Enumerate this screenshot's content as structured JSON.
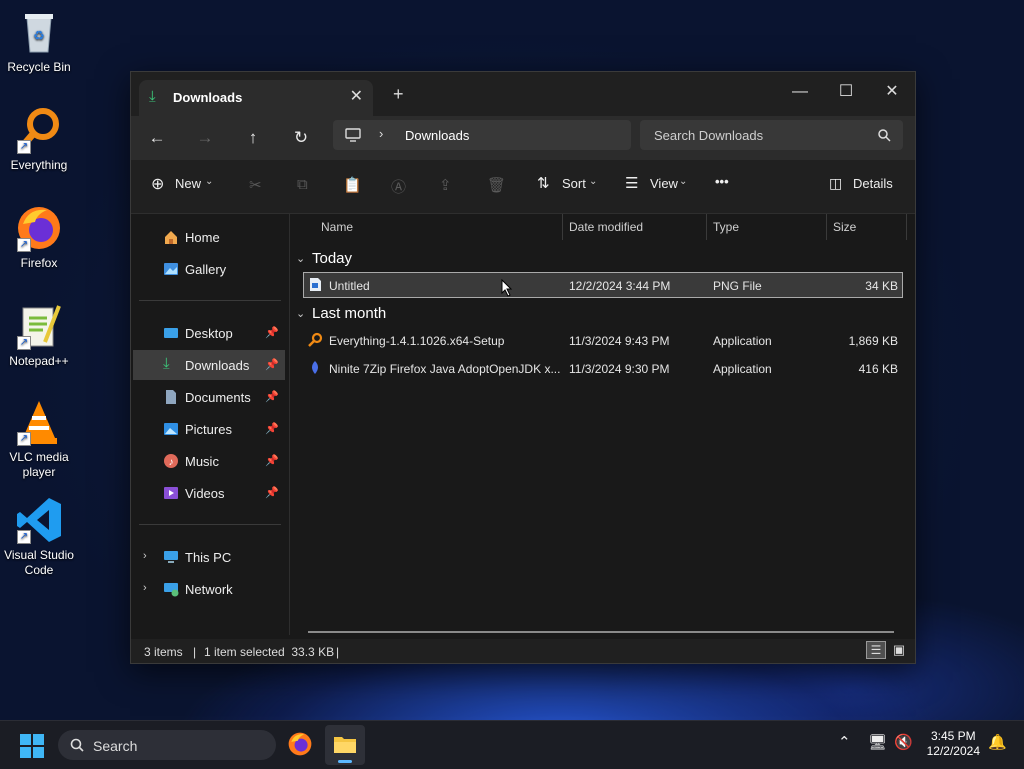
{
  "desktop": {
    "icons": [
      {
        "label": "Recycle Bin"
      },
      {
        "label": "Everything"
      },
      {
        "label": "Firefox"
      },
      {
        "label": "Notepad++"
      },
      {
        "label": "VLC media player"
      },
      {
        "label": "Visual Studio Code"
      }
    ]
  },
  "window": {
    "tab_title": "Downloads",
    "tab_close": "✕",
    "new_tab": "+",
    "minimize": "—",
    "maximize": "☐",
    "close": "✕"
  },
  "nav": {
    "back": "←",
    "forward": "→",
    "up": "↑",
    "refresh": "↻",
    "address": "Downloads",
    "search_placeholder": "Search Downloads"
  },
  "command_bar": {
    "new_label": "New",
    "sort_label": "Sort",
    "view_label": "View",
    "more": "•••",
    "details_label": "Details"
  },
  "sidebar": {
    "items": [
      {
        "label": "Home",
        "icon": "home-icon"
      },
      {
        "label": "Gallery",
        "icon": "gallery-icon"
      },
      {
        "label": "Desktop",
        "icon": "desktop-icon"
      },
      {
        "label": "Downloads",
        "icon": "download-icon"
      },
      {
        "label": "Documents",
        "icon": "documents-icon"
      },
      {
        "label": "Pictures",
        "icon": "pictures-icon"
      },
      {
        "label": "Music",
        "icon": "music-icon"
      },
      {
        "label": "Videos",
        "icon": "videos-icon"
      },
      {
        "label": "This PC",
        "icon": "pc-icon"
      },
      {
        "label": "Network",
        "icon": "network-icon"
      }
    ]
  },
  "columns": {
    "name": "Name",
    "date": "Date modified",
    "type": "Type",
    "size": "Size"
  },
  "groups": [
    {
      "label": "Today",
      "files": [
        {
          "name": "Untitled",
          "date": "12/2/2024 3:44 PM",
          "type": "PNG File",
          "size": "34 KB"
        }
      ]
    },
    {
      "label": "Last month",
      "files": [
        {
          "name": "Everything-1.4.1.1026.x64-Setup",
          "date": "11/3/2024 9:43 PM",
          "type": "Application",
          "size": "1,869 KB"
        },
        {
          "name": "Ninite 7Zip Firefox Java AdoptOpenJDK x...",
          "date": "11/3/2024 9:30 PM",
          "type": "Application",
          "size": "416 KB"
        }
      ]
    }
  ],
  "status": {
    "items": "3 items",
    "selected": "1 item selected  33.3 KB"
  },
  "taskbar": {
    "search_label": "Search",
    "time": "3:45 PM",
    "date": "12/2/2024"
  }
}
